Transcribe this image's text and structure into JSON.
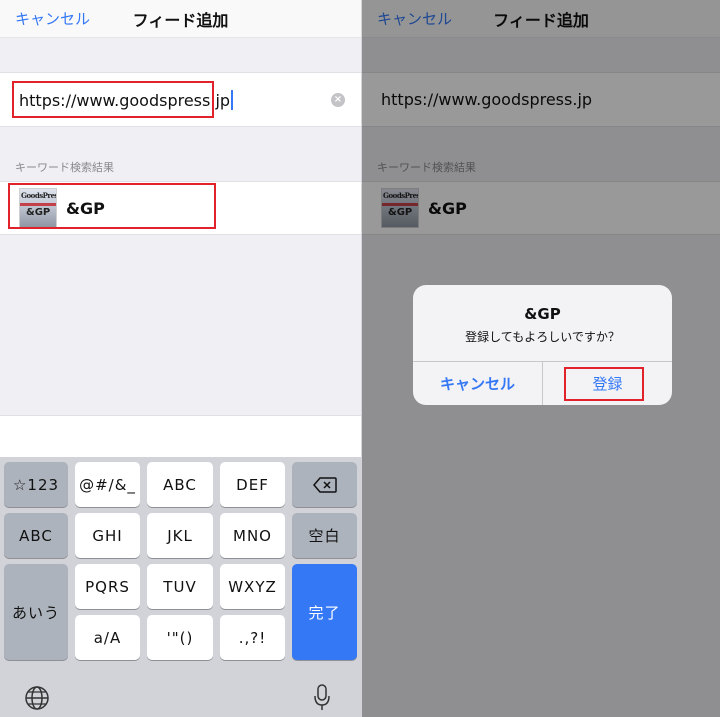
{
  "left": {
    "nav": {
      "cancel": "キャンセル",
      "title": "フィード追加"
    },
    "url_field": {
      "value": "https://www.goodspress.jp"
    },
    "section_header": "キーワード検索結果",
    "result": {
      "label": "&GP",
      "thumb_text_top": "GoodsPress",
      "thumb_text_bottom": "&GP"
    },
    "keyboard": {
      "row1": [
        "☆123",
        "@#/&_",
        "ABC",
        "DEF"
      ],
      "row2": [
        "ABC",
        "GHI",
        "JKL",
        "MNO",
        "空白"
      ],
      "row3": [
        "あいう",
        "PQRS",
        "TUV",
        "WXYZ",
        "完了"
      ],
      "row4": [
        "a/A",
        "'\"()",
        ".,?!"
      ],
      "icons": [
        "backspace-icon",
        "globe-icon",
        "microphone-icon"
      ]
    }
  },
  "right": {
    "nav": {
      "cancel": "キャンセル",
      "title": "フィード追加"
    },
    "url_field": {
      "value": "https://www.goodspress.jp"
    },
    "section_header": "キーワード検索結果",
    "result": {
      "label": "&GP",
      "thumb_text_top": "GoodsPress",
      "thumb_text_bottom": "&GP"
    },
    "alert": {
      "title": "&GP",
      "message": "登録してもよろしいですか？",
      "cancel": "キャンセル",
      "confirm": "登録"
    }
  },
  "colors": {
    "accent": "#3478f6",
    "highlight": "#e0232b",
    "overlay": "rgba(0,0,0,0.40)"
  }
}
